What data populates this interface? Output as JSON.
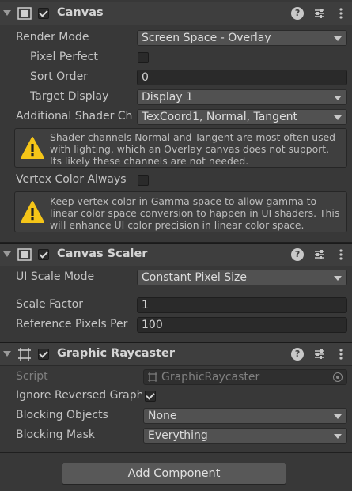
{
  "canvas": {
    "title": "Canvas",
    "enabled": true,
    "render_mode": {
      "label": "Render Mode",
      "value": "Screen Space - Overlay"
    },
    "pixel_perfect": {
      "label": "Pixel Perfect",
      "checked": false
    },
    "sort_order": {
      "label": "Sort Order",
      "value": "0"
    },
    "target_display": {
      "label": "Target Display",
      "value": "Display 1"
    },
    "additional_shader": {
      "label": "Additional Shader Ch",
      "value": "TexCoord1, Normal, Tangent"
    },
    "warning1": "Shader channels Normal and Tangent are most often used with lighting, which an Overlay canvas does not support. Its likely these channels are not needed.",
    "vertex_color": {
      "label": "Vertex Color Always",
      "checked": false
    },
    "warning2": "Keep vertex color in Gamma space to allow gamma to linear color space conversion to happen in UI shaders. This will enhance UI color precision in linear color space."
  },
  "canvas_scaler": {
    "title": "Canvas Scaler",
    "enabled": true,
    "ui_scale_mode": {
      "label": "UI Scale Mode",
      "value": "Constant Pixel Size"
    },
    "scale_factor": {
      "label": "Scale Factor",
      "value": "1"
    },
    "reference_pixels": {
      "label": "Reference Pixels Per",
      "value": "100"
    }
  },
  "graphic_raycaster": {
    "title": "Graphic Raycaster",
    "enabled": true,
    "script": {
      "label": "Script",
      "value": "GraphicRaycaster"
    },
    "ignore_reversed": {
      "label": "Ignore Reversed Graph",
      "checked": true
    },
    "blocking_objects": {
      "label": "Blocking Objects",
      "value": "None"
    },
    "blocking_mask": {
      "label": "Blocking Mask",
      "value": "Everything"
    }
  },
  "add_component_label": "Add Component",
  "icons": {
    "help": "help-icon",
    "presets": "presets-icon",
    "more": "more-menu-icon",
    "warning": "warning-icon"
  },
  "help_glyph": "?"
}
